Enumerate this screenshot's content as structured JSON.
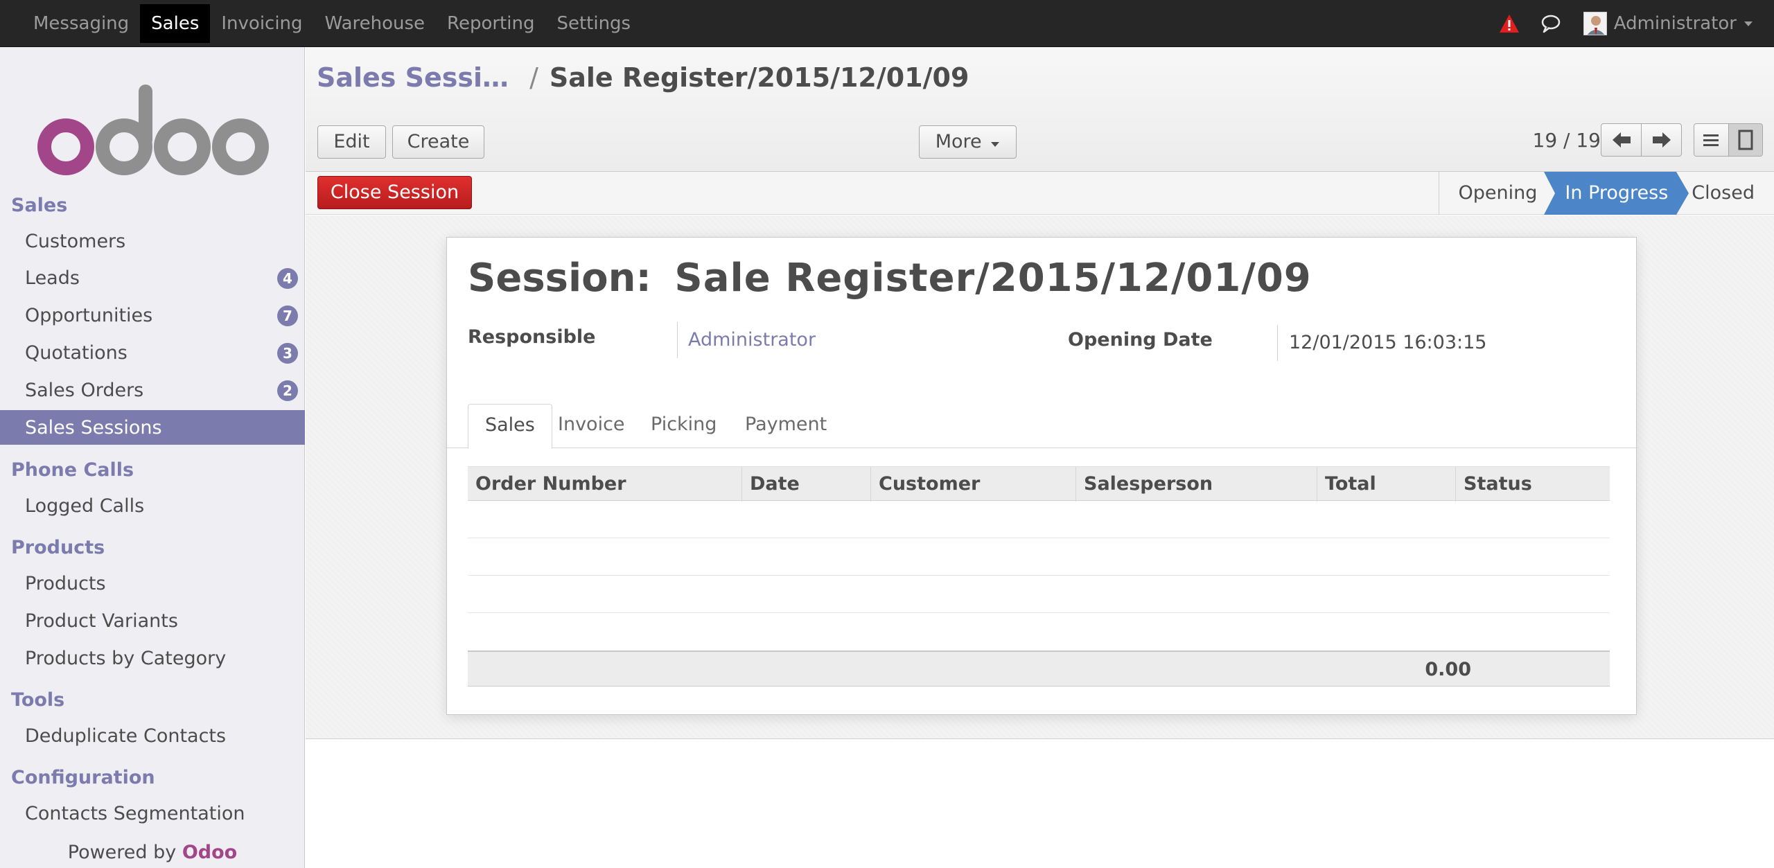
{
  "topbar": {
    "menu": [
      "Messaging",
      "Sales",
      "Invoicing",
      "Warehouse",
      "Reporting",
      "Settings"
    ],
    "active": "Sales",
    "user": "Administrator"
  },
  "sidebar": {
    "sections": [
      {
        "title": "Sales",
        "items": [
          {
            "label": "Customers"
          },
          {
            "label": "Leads",
            "badge": "4"
          },
          {
            "label": "Opportunities",
            "badge": "7"
          },
          {
            "label": "Quotations",
            "badge": "3"
          },
          {
            "label": "Sales Orders",
            "badge": "2"
          },
          {
            "label": "Sales Sessions",
            "active": true
          }
        ]
      },
      {
        "title": "Phone Calls",
        "items": [
          {
            "label": "Logged Calls"
          }
        ]
      },
      {
        "title": "Products",
        "items": [
          {
            "label": "Products"
          },
          {
            "label": "Product Variants"
          },
          {
            "label": "Products by Category"
          }
        ]
      },
      {
        "title": "Tools",
        "items": [
          {
            "label": "Deduplicate Contacts"
          }
        ]
      },
      {
        "title": "Configuration",
        "items": [
          {
            "label": "Contacts Segmentation"
          }
        ]
      }
    ],
    "powered_prefix": "Powered by",
    "powered_brand": "Odoo",
    "logo_text": "odoo"
  },
  "control_panel": {
    "breadcrumb_parent": "Sales Sessi…",
    "breadcrumb_sep": "/",
    "breadcrumb_current": "Sale Register/2015/12/01/09",
    "edit_label": "Edit",
    "create_label": "Create",
    "more_label": "More",
    "pager": "19 / 19"
  },
  "statusbar": {
    "close_label": "Close Session",
    "stages": [
      "Opening",
      "In Progress",
      "Closed"
    ],
    "current_stage": "In Progress"
  },
  "form": {
    "title_label": "Session:",
    "title_value": "Sale Register/2015/12/01/09",
    "responsible_label": "Responsible",
    "responsible_value": "Administrator",
    "opening_date_label": "Opening Date",
    "opening_date_value": "12/01/2015 16:03:15",
    "tabs": [
      "Sales",
      "Invoice",
      "Picking",
      "Payment"
    ],
    "active_tab": "Sales",
    "columns": [
      "Order Number",
      "Date",
      "Customer",
      "Salesperson",
      "Total",
      "Status"
    ],
    "total": "0.00"
  },
  "colors": {
    "accent": "#7c7bad",
    "brand": "#a24689",
    "danger": "#cc2222",
    "stage_current": "#4c86c9",
    "topbar": "#262626"
  }
}
